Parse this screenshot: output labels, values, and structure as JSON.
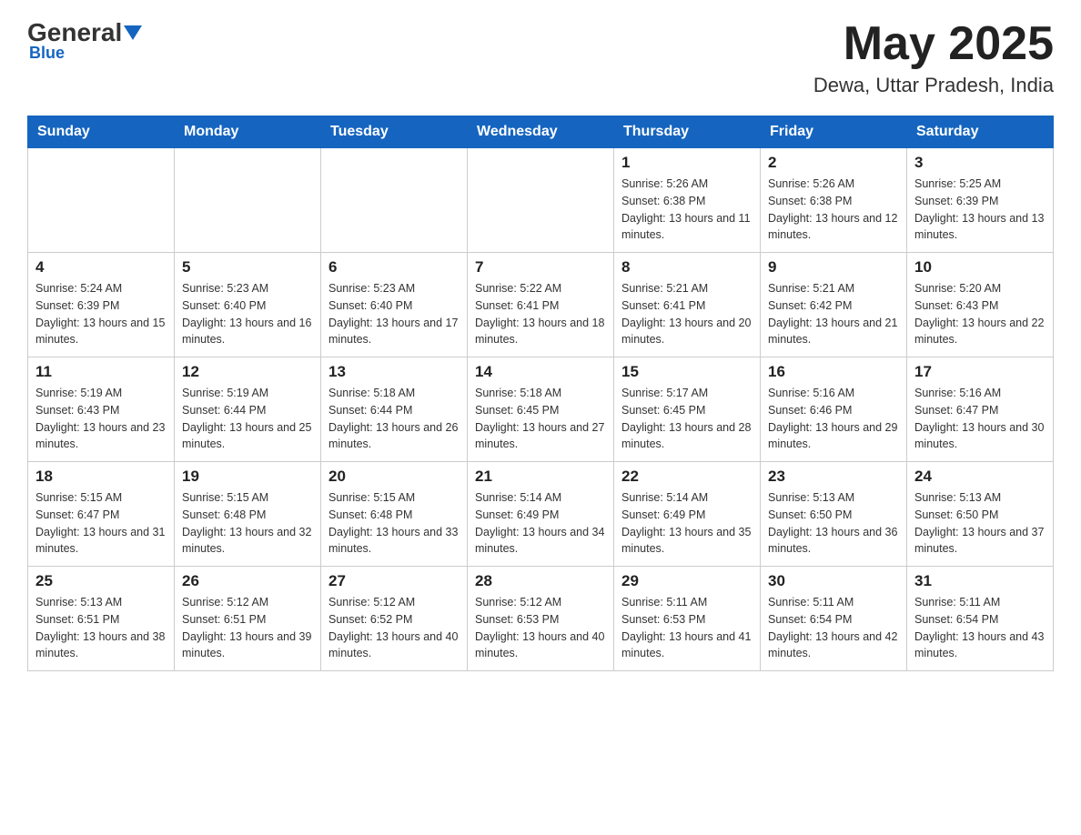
{
  "header": {
    "logo_general": "General",
    "logo_blue": "Blue",
    "title": "May 2025",
    "subtitle": "Dewa, Uttar Pradesh, India"
  },
  "days_of_week": [
    "Sunday",
    "Monday",
    "Tuesday",
    "Wednesday",
    "Thursday",
    "Friday",
    "Saturday"
  ],
  "weeks": [
    [
      {
        "day": "",
        "info": ""
      },
      {
        "day": "",
        "info": ""
      },
      {
        "day": "",
        "info": ""
      },
      {
        "day": "",
        "info": ""
      },
      {
        "day": "1",
        "info": "Sunrise: 5:26 AM\nSunset: 6:38 PM\nDaylight: 13 hours and 11 minutes."
      },
      {
        "day": "2",
        "info": "Sunrise: 5:26 AM\nSunset: 6:38 PM\nDaylight: 13 hours and 12 minutes."
      },
      {
        "day": "3",
        "info": "Sunrise: 5:25 AM\nSunset: 6:39 PM\nDaylight: 13 hours and 13 minutes."
      }
    ],
    [
      {
        "day": "4",
        "info": "Sunrise: 5:24 AM\nSunset: 6:39 PM\nDaylight: 13 hours and 15 minutes."
      },
      {
        "day": "5",
        "info": "Sunrise: 5:23 AM\nSunset: 6:40 PM\nDaylight: 13 hours and 16 minutes."
      },
      {
        "day": "6",
        "info": "Sunrise: 5:23 AM\nSunset: 6:40 PM\nDaylight: 13 hours and 17 minutes."
      },
      {
        "day": "7",
        "info": "Sunrise: 5:22 AM\nSunset: 6:41 PM\nDaylight: 13 hours and 18 minutes."
      },
      {
        "day": "8",
        "info": "Sunrise: 5:21 AM\nSunset: 6:41 PM\nDaylight: 13 hours and 20 minutes."
      },
      {
        "day": "9",
        "info": "Sunrise: 5:21 AM\nSunset: 6:42 PM\nDaylight: 13 hours and 21 minutes."
      },
      {
        "day": "10",
        "info": "Sunrise: 5:20 AM\nSunset: 6:43 PM\nDaylight: 13 hours and 22 minutes."
      }
    ],
    [
      {
        "day": "11",
        "info": "Sunrise: 5:19 AM\nSunset: 6:43 PM\nDaylight: 13 hours and 23 minutes."
      },
      {
        "day": "12",
        "info": "Sunrise: 5:19 AM\nSunset: 6:44 PM\nDaylight: 13 hours and 25 minutes."
      },
      {
        "day": "13",
        "info": "Sunrise: 5:18 AM\nSunset: 6:44 PM\nDaylight: 13 hours and 26 minutes."
      },
      {
        "day": "14",
        "info": "Sunrise: 5:18 AM\nSunset: 6:45 PM\nDaylight: 13 hours and 27 minutes."
      },
      {
        "day": "15",
        "info": "Sunrise: 5:17 AM\nSunset: 6:45 PM\nDaylight: 13 hours and 28 minutes."
      },
      {
        "day": "16",
        "info": "Sunrise: 5:16 AM\nSunset: 6:46 PM\nDaylight: 13 hours and 29 minutes."
      },
      {
        "day": "17",
        "info": "Sunrise: 5:16 AM\nSunset: 6:47 PM\nDaylight: 13 hours and 30 minutes."
      }
    ],
    [
      {
        "day": "18",
        "info": "Sunrise: 5:15 AM\nSunset: 6:47 PM\nDaylight: 13 hours and 31 minutes."
      },
      {
        "day": "19",
        "info": "Sunrise: 5:15 AM\nSunset: 6:48 PM\nDaylight: 13 hours and 32 minutes."
      },
      {
        "day": "20",
        "info": "Sunrise: 5:15 AM\nSunset: 6:48 PM\nDaylight: 13 hours and 33 minutes."
      },
      {
        "day": "21",
        "info": "Sunrise: 5:14 AM\nSunset: 6:49 PM\nDaylight: 13 hours and 34 minutes."
      },
      {
        "day": "22",
        "info": "Sunrise: 5:14 AM\nSunset: 6:49 PM\nDaylight: 13 hours and 35 minutes."
      },
      {
        "day": "23",
        "info": "Sunrise: 5:13 AM\nSunset: 6:50 PM\nDaylight: 13 hours and 36 minutes."
      },
      {
        "day": "24",
        "info": "Sunrise: 5:13 AM\nSunset: 6:50 PM\nDaylight: 13 hours and 37 minutes."
      }
    ],
    [
      {
        "day": "25",
        "info": "Sunrise: 5:13 AM\nSunset: 6:51 PM\nDaylight: 13 hours and 38 minutes."
      },
      {
        "day": "26",
        "info": "Sunrise: 5:12 AM\nSunset: 6:51 PM\nDaylight: 13 hours and 39 minutes."
      },
      {
        "day": "27",
        "info": "Sunrise: 5:12 AM\nSunset: 6:52 PM\nDaylight: 13 hours and 40 minutes."
      },
      {
        "day": "28",
        "info": "Sunrise: 5:12 AM\nSunset: 6:53 PM\nDaylight: 13 hours and 40 minutes."
      },
      {
        "day": "29",
        "info": "Sunrise: 5:11 AM\nSunset: 6:53 PM\nDaylight: 13 hours and 41 minutes."
      },
      {
        "day": "30",
        "info": "Sunrise: 5:11 AM\nSunset: 6:54 PM\nDaylight: 13 hours and 42 minutes."
      },
      {
        "day": "31",
        "info": "Sunrise: 5:11 AM\nSunset: 6:54 PM\nDaylight: 13 hours and 43 minutes."
      }
    ]
  ]
}
